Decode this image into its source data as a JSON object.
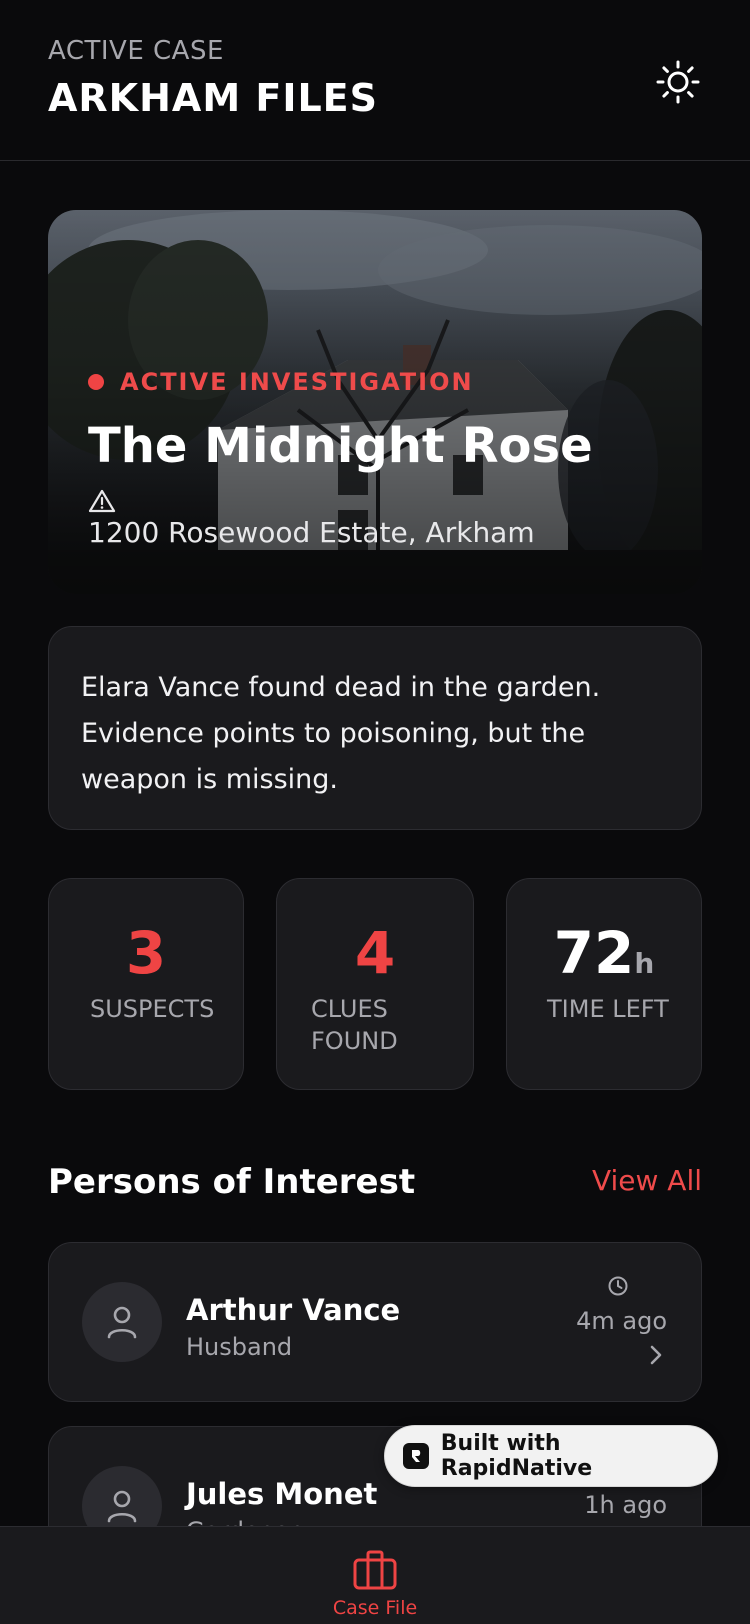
{
  "header": {
    "eyebrow": "ACTIVE CASE",
    "title": "ARKHAM FILES",
    "theme_icon": "sun-icon"
  },
  "hero": {
    "badge": "ACTIVE INVESTIGATION",
    "title": "The Midnight Rose",
    "address_icon": "warning-icon",
    "address": "1200 Rosewood Estate, Arkham",
    "accent": "#ef4444"
  },
  "summary": {
    "text": "Elara Vance found dead in the garden. Evidence points to poisoning, but the weapon is missing."
  },
  "stats": [
    {
      "value": "3",
      "label": "SUSPECTS"
    },
    {
      "value": "4",
      "label": "CLUES FOUND"
    },
    {
      "value": "72",
      "unit": "h",
      "label": "TIME LEFT"
    }
  ],
  "persons": {
    "title": "Persons of Interest",
    "view_all": "View All",
    "items": [
      {
        "name": "Arthur Vance",
        "role": "Husband",
        "time": "4m ago"
      },
      {
        "name": "Jules Monet",
        "role": "Gardener",
        "time": "1h ago"
      }
    ]
  },
  "badge": {
    "text": "Built with RapidNative"
  },
  "tabbar": {
    "items": [
      {
        "label": "Case File",
        "icon": "briefcase-icon",
        "active": true
      }
    ]
  },
  "colors": {
    "background": "#0a0a0c",
    "card": "#1a1a1d",
    "accent": "#ef4444"
  }
}
